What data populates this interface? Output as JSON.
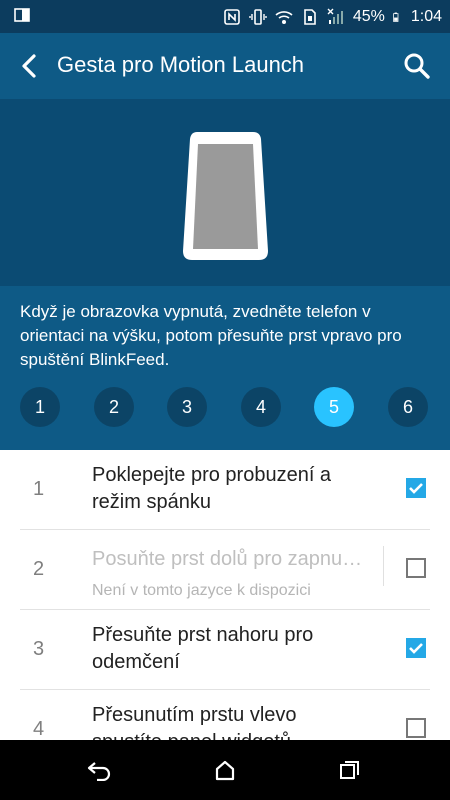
{
  "status_bar": {
    "battery_percent": "45%",
    "time": "1:04",
    "icons": [
      "screen-mirror-icon",
      "nfc-icon",
      "vibrate-icon",
      "wifi-icon",
      "sim-icon",
      "signal-icon",
      "battery-icon"
    ]
  },
  "app_bar": {
    "title": "Gesta pro Motion Launch",
    "back_icon": "back-arrow-icon",
    "search_icon": "search-icon"
  },
  "gesture": {
    "description": "Když je obrazovka vypnutá, zvedněte telefon v orientaci na výšku, potom přesuňte prst vpravo pro spuštění BlinkFeed.",
    "steps": [
      "1",
      "2",
      "3",
      "4",
      "5",
      "6"
    ],
    "active_step": "5"
  },
  "settings": {
    "items": [
      {
        "number": "1",
        "label": "Poklepejte pro probuzení a režim spánku",
        "sublabel": "",
        "checked": true,
        "enabled": true
      },
      {
        "number": "2",
        "label": "Posuňte prst dolů pro zapnu…",
        "sublabel": "Není v tomto jazyce k dispozici",
        "checked": false,
        "enabled": false
      },
      {
        "number": "3",
        "label": "Přesuňte prst nahoru pro odemčení",
        "sublabel": "",
        "checked": true,
        "enabled": true
      },
      {
        "number": "4",
        "label": "Přesunutím prstu vlevo spustíte panel widgetů",
        "sublabel": "",
        "checked": false,
        "enabled": true
      }
    ]
  },
  "colors": {
    "status_bar": "#0c3c5e",
    "app_bar": "#0e5a86",
    "hero": "#0b4b73",
    "accent": "#29c3ff",
    "checkbox": "#24a8e6"
  },
  "nav_bar": {
    "icons": [
      "back-icon",
      "home-icon",
      "recents-icon"
    ]
  }
}
